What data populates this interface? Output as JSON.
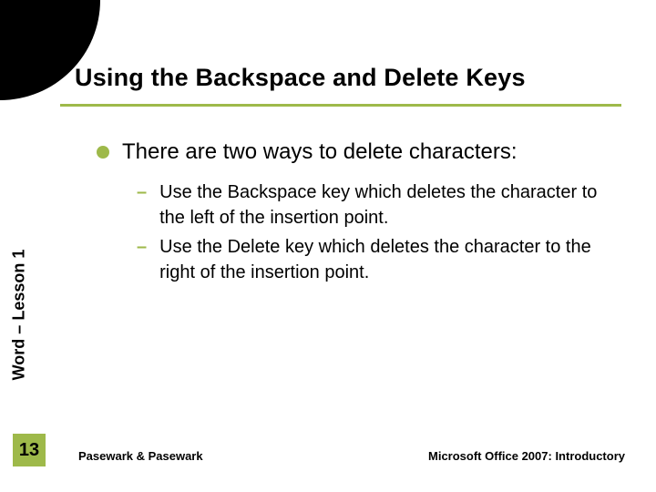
{
  "title": "Using the Backspace and Delete Keys",
  "main_bullet": "There are two ways to delete characters:",
  "sub_bullets": [
    "Use the Backspace key which deletes the character to the left of the insertion point.",
    "Use the Delete key which deletes the character to the right of the insertion point."
  ],
  "side_label": "Word – Lesson 1",
  "page_number": "13",
  "footer_left": "Pasewark & Pasewark",
  "footer_right": "Microsoft Office 2007:  Introductory",
  "colors": {
    "accent": "#9eb94a"
  }
}
